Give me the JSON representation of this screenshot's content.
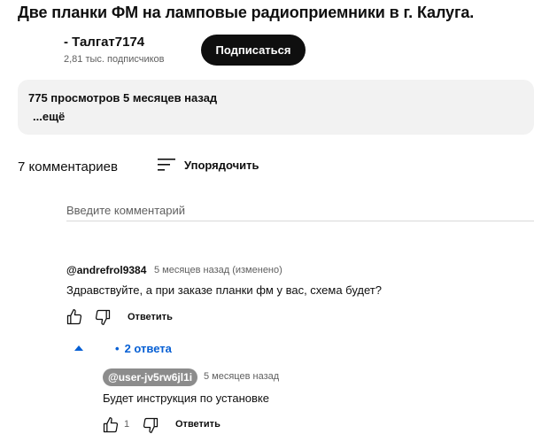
{
  "video": {
    "title": "Две планки ФМ на ламповые радиоприемники в г. Калуга."
  },
  "channel": {
    "name": "- Талгат7174",
    "subscribers": "2,81 тыс. подписчиков",
    "subscribe_label": "Подписаться"
  },
  "description": {
    "meta": "775 просмотров  5 месяцев назад",
    "more": "...ещё"
  },
  "comments_section": {
    "count_label": "7 комментариев",
    "sort_label": "Упорядочить",
    "input_placeholder": "Введите комментарий"
  },
  "comments": [
    {
      "author": "@andrefrol9384",
      "timestamp": "5 месяцев назад (изменено)",
      "text": "Здравствуйте, а при заказе планки фм у вас, схема будет?",
      "reply_label": "Ответить",
      "replies_toggle": "2 ответа"
    }
  ],
  "replies": [
    {
      "author": "@user-jv5rw6jl1i",
      "timestamp": "5 месяцев назад",
      "text": "Будет инструкция по установке",
      "likes": "1",
      "reply_label": "Ответить"
    }
  ],
  "icons": {
    "sort": "sort-icon",
    "like": "thumbs-up-icon",
    "dislike": "thumbs-down-icon",
    "expand": "caret-up-icon"
  },
  "colors": {
    "link_blue": "#065fd4",
    "subscribe_bg": "#0f0f0f",
    "description_bg": "#f2f2f2",
    "author_badge_bg": "#8c8c8c"
  }
}
